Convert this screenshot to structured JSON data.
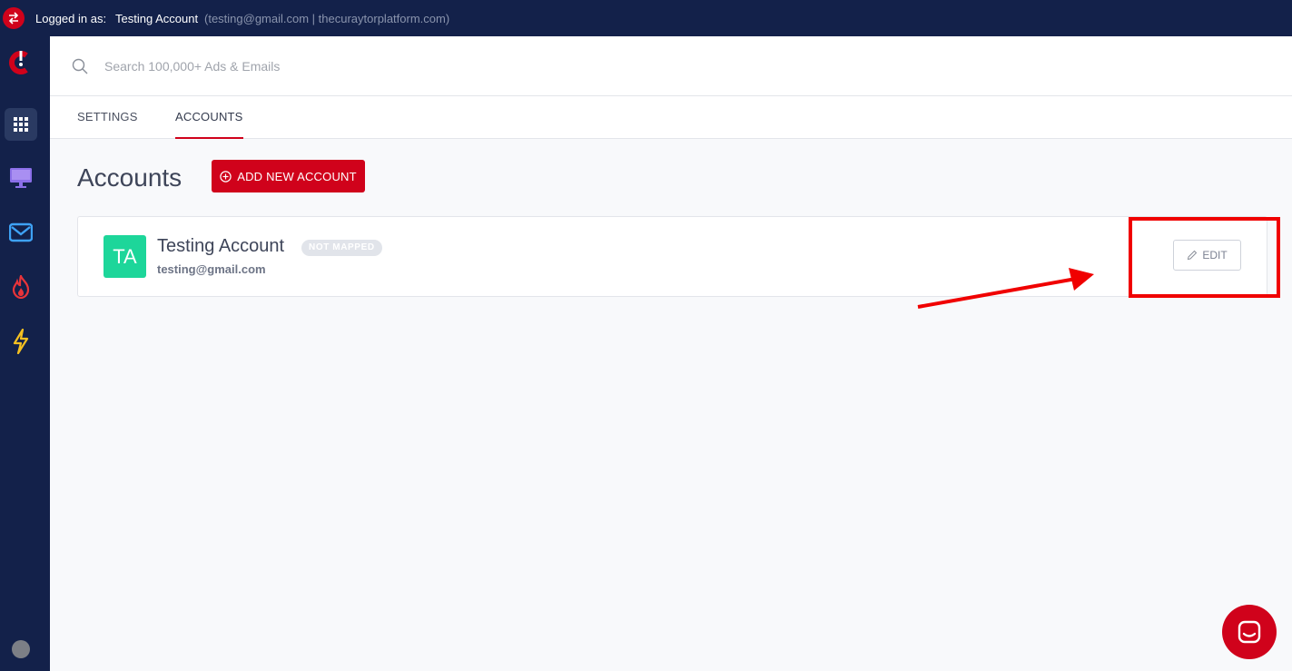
{
  "topbar": {
    "logged_label": "Logged in as:",
    "account_name": "Testing Account",
    "account_detail": "(testing@gmail.com | thecuraytorplatform.com)"
  },
  "sidebar": {
    "items": [
      {
        "name": "logo",
        "icon": "curaytor-logo-icon"
      },
      {
        "name": "apps",
        "icon": "grid-icon",
        "active": true
      },
      {
        "name": "ads",
        "icon": "monitor-icon"
      },
      {
        "name": "emails",
        "icon": "mail-icon"
      },
      {
        "name": "trending",
        "icon": "fire-icon"
      },
      {
        "name": "automation",
        "icon": "lightning-icon"
      }
    ]
  },
  "search": {
    "placeholder": "Search 100,000+ Ads & Emails",
    "value": ""
  },
  "tabs": [
    {
      "label": "SETTINGS",
      "active": false
    },
    {
      "label": "ACCOUNTS",
      "active": true
    }
  ],
  "page": {
    "title": "Accounts",
    "add_button_label": "ADD NEW ACCOUNT"
  },
  "accounts": [
    {
      "initials": "TA",
      "name": "Testing Account",
      "badge": "NOT MAPPED",
      "email": "testing@gmail.com",
      "edit_label": "EDIT"
    }
  ],
  "colors": {
    "brand_red": "#d0021b",
    "nav_bg": "#13214a",
    "avatar_green": "#1dd69a",
    "annotation_red": "#f00000"
  }
}
